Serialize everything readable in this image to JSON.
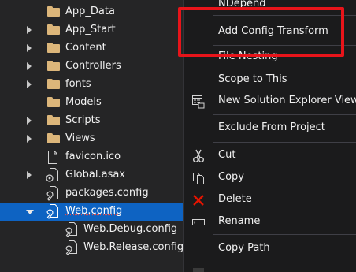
{
  "tree": {
    "items": [
      {
        "label": "App_Data"
      },
      {
        "label": "App_Start"
      },
      {
        "label": "Content"
      },
      {
        "label": "Controllers"
      },
      {
        "label": "fonts"
      },
      {
        "label": "Models"
      },
      {
        "label": "Scripts"
      },
      {
        "label": "Views"
      },
      {
        "label": "favicon.ico"
      },
      {
        "label": "Global.asax"
      },
      {
        "label": "packages.config"
      },
      {
        "label": "Web.config",
        "selected": true
      },
      {
        "label": "Web.Debug.config"
      },
      {
        "label": "Web.Release.config"
      }
    ]
  },
  "menu": {
    "items": [
      {
        "label": "NDepend"
      },
      {
        "label": "Add Config Transform"
      },
      {
        "label": "File Nesting"
      },
      {
        "label": "Scope to This"
      },
      {
        "label": "New Solution Explorer View"
      },
      {
        "label": "Exclude From Project"
      },
      {
        "label": "Cut",
        "icon": "scissors-icon"
      },
      {
        "label": "Copy",
        "icon": "copy-icon"
      },
      {
        "label": "Delete",
        "icon": "delete-icon"
      },
      {
        "label": "Rename",
        "icon": "rename-icon"
      },
      {
        "label": "Copy Path"
      }
    ]
  },
  "colors": {
    "selection": "#0e63c2",
    "highlight_box": "#e8141a",
    "delete_icon": "#e51400",
    "folder": "#dcb67a"
  }
}
